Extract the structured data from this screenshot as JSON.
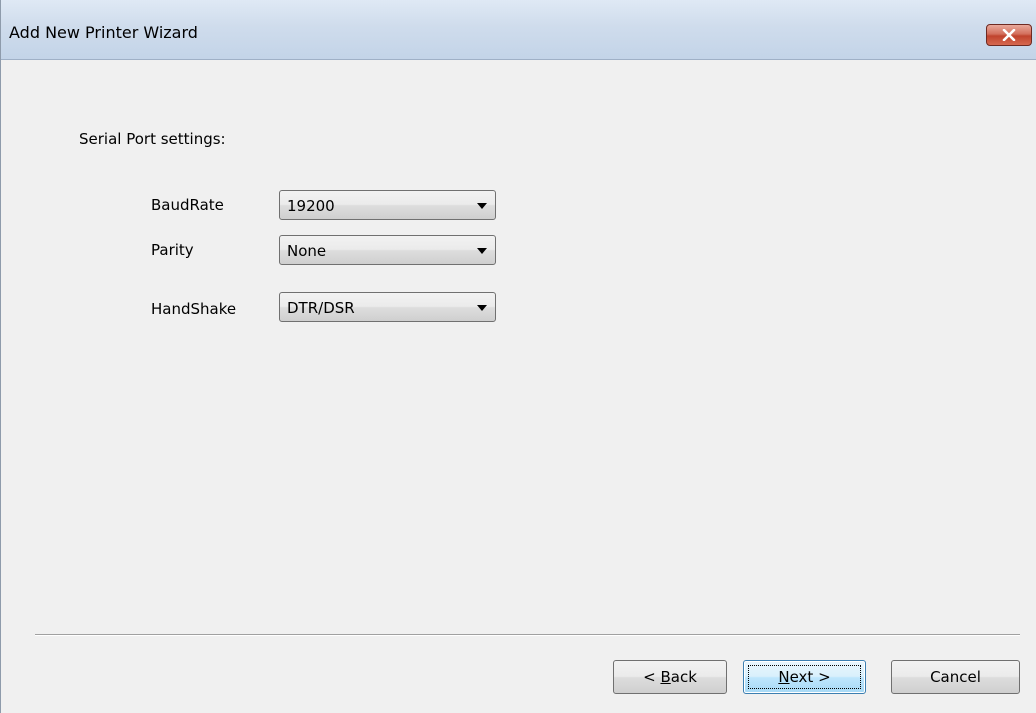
{
  "window": {
    "title": "Add New Printer Wizard"
  },
  "icons": {
    "close": "close-icon",
    "dropdown": "chevron-down-icon"
  },
  "page": {
    "section_label": "Serial Port settings:",
    "fields": {
      "baudrate": {
        "label": "BaudRate",
        "value": "19200"
      },
      "parity": {
        "label": "Parity",
        "value": "None"
      },
      "handshake": {
        "label": "HandShake",
        "value": "DTR/DSR"
      }
    }
  },
  "buttons": {
    "back": {
      "prefix": "< ",
      "mnemonic": "B",
      "rest": "ack"
    },
    "next": {
      "prefix": "",
      "mnemonic": "N",
      "rest": "ext >"
    },
    "cancel": {
      "label": "Cancel"
    }
  },
  "colors": {
    "close_button": "#c0432d",
    "default_button_border": "#3c7fb1"
  }
}
